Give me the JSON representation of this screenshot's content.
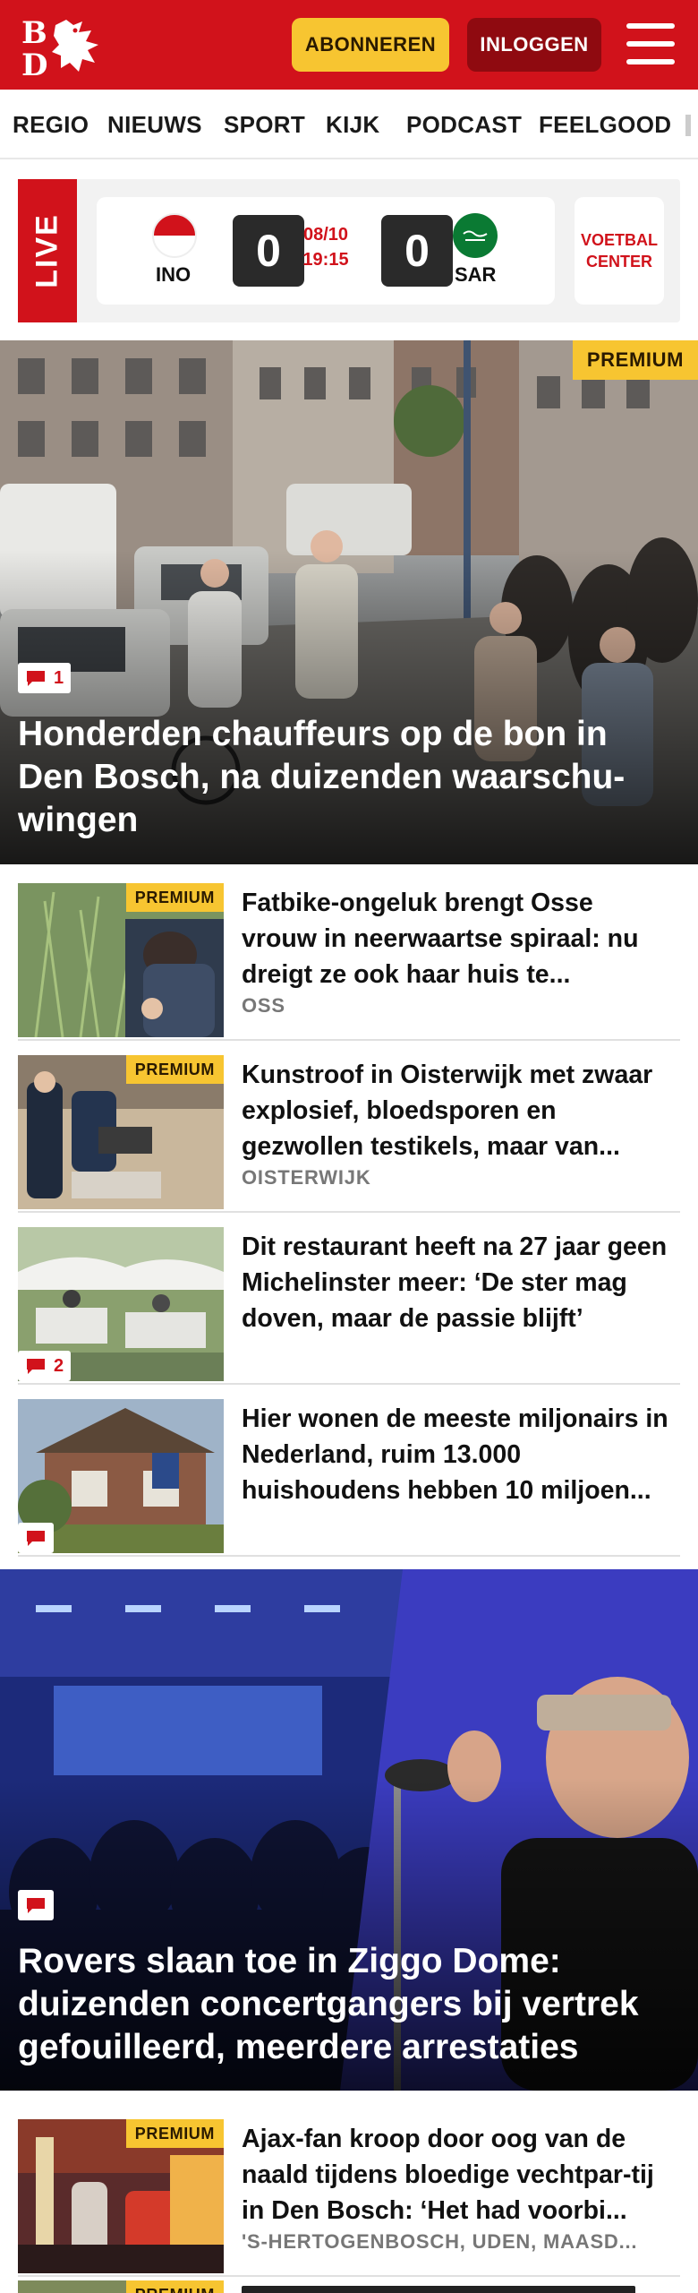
{
  "header": {
    "logo_letters": "BD",
    "subscribe_label": "ABONNEREN",
    "login_label": "INLOGGEN",
    "brand_color": "#d1121b",
    "accent_color": "#f7c531"
  },
  "nav": {
    "items": [
      "REGIO",
      "NIEUWS",
      "SPORT",
      "KIJK",
      "PODCAST",
      "FEELGOOD"
    ]
  },
  "live": {
    "label": "LIVE",
    "home_code": "INO",
    "away_code": "SAR",
    "home_score": "0",
    "away_score": "0",
    "date": "08/10",
    "time": "19:15",
    "center_label": "VOETBAL CENTER"
  },
  "hero1": {
    "premium": "PREMIUM",
    "comments": "1",
    "title": "Honderden chauffeurs op de bon in Den Bosch, na duizenden waarschu-wingen"
  },
  "articles": [
    {
      "premium": "PREMIUM",
      "title": "Fatbike-ongeluk brengt Osse vrouw in neerwaartse spiraal: nu dreigt ze ook haar huis te...",
      "location": "OSS",
      "comments": ""
    },
    {
      "premium": "PREMIUM",
      "title": "Kunstroof in Oisterwijk met zwaar explosief, bloedsporen en gezwollen testikels, maar van...",
      "location": "OISTERWIJK",
      "comments": ""
    },
    {
      "premium": "",
      "title": "Dit restaurant heeft na 27 jaar geen Michelinster meer: ‘De ster mag doven, maar de passie blijft’",
      "location": "",
      "comments": "2"
    },
    {
      "premium": "",
      "title": "Hier wonen de meeste miljonairs in Nederland, ruim 13.000 huishoudens hebben 10 miljoen...",
      "location": "",
      "comments": ""
    }
  ],
  "hero2": {
    "title": "Rovers slaan toe in Ziggo Dome: duizenden concertgangers bij vertrek gefouilleerd, meerdere arrestaties"
  },
  "article5": {
    "premium": "PREMIUM",
    "title": "Ajax-fan kroop door oog van de naald tijdens bloedige vechtpar-tij in Den Bosch: ‘Het had voorbi...",
    "location": "'S-HERTOGENBOSCH, UDEN, MAASD..."
  },
  "article6": {
    "premium": "PREMIUM"
  }
}
